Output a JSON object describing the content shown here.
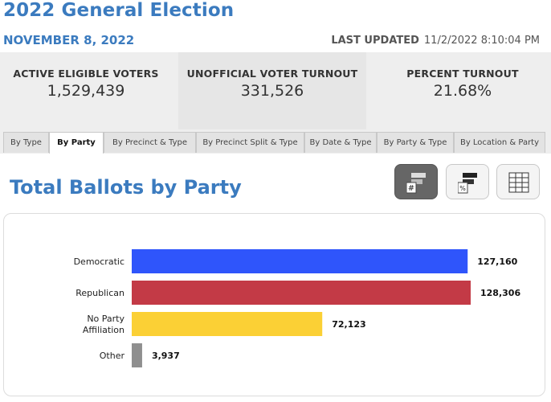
{
  "header": {
    "title": "2022 General Election",
    "date": "NOVEMBER 8, 2022",
    "last_updated_label": "LAST UPDATED",
    "last_updated_value": "11/2/2022 8:10:04 PM"
  },
  "stats": [
    {
      "label": "ACTIVE ELIGIBLE VOTERS",
      "value": "1,529,439"
    },
    {
      "label": "UNOFFICIAL VOTER TURNOUT",
      "value": "331,526"
    },
    {
      "label": "PERCENT TURNOUT",
      "value": "21.68%"
    }
  ],
  "tabs": [
    {
      "label": "By Type",
      "active": false
    },
    {
      "label": "By Party",
      "active": true
    },
    {
      "label": "By Precinct & Type",
      "active": false
    },
    {
      "label": "By Precinct Split & Type",
      "active": false
    },
    {
      "label": "By Date & Type",
      "active": false
    },
    {
      "label": "By Party & Type",
      "active": false
    },
    {
      "label": "By Location & Party",
      "active": false
    }
  ],
  "section_title": "Total Ballots by Party",
  "view_buttons": [
    {
      "icon": "bar-count-icon",
      "active": true
    },
    {
      "icon": "bar-percent-icon",
      "active": false
    },
    {
      "icon": "table-icon",
      "active": false
    }
  ],
  "colors": {
    "accent": "#3b7bbf"
  },
  "chart_data": {
    "type": "bar",
    "orientation": "horizontal",
    "categories": [
      "Democratic",
      "Republican",
      "No Party Affiliation",
      "Other"
    ],
    "category_lines": [
      [
        "Democratic"
      ],
      [
        "Republican"
      ],
      [
        "No Party",
        "Affiliation"
      ],
      [
        "Other"
      ]
    ],
    "values": [
      127160,
      128306,
      72123,
      3937
    ],
    "value_labels": [
      "127,160",
      "128,306",
      "72,123",
      "3,937"
    ],
    "colors": [
      "#2f55fb",
      "#c33a46",
      "#fbd035",
      "#8f8f8f"
    ],
    "xlim": [
      0,
      128306
    ],
    "grid": false
  }
}
